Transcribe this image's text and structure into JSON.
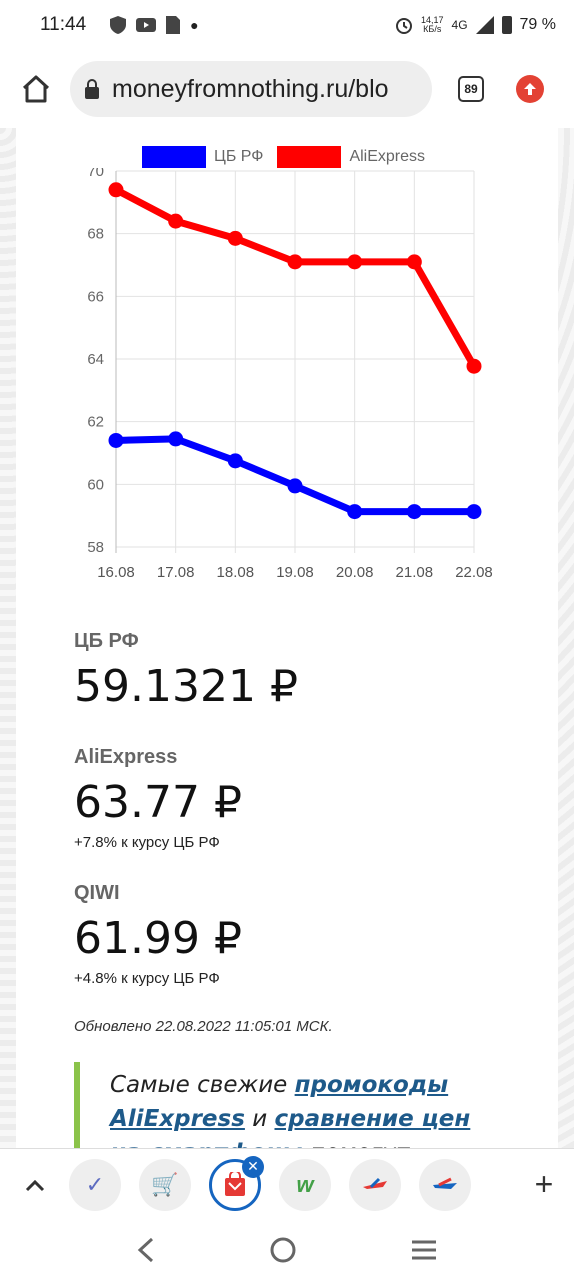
{
  "status": {
    "time": "11:44",
    "speed_top": "14,17",
    "speed_unit": "КБ/s",
    "network": "4G",
    "battery": "79 %"
  },
  "browser": {
    "url": "moneyfromnothing.ru/blo",
    "tabs_count": "89"
  },
  "chart_data": {
    "type": "line",
    "x": [
      "16.08",
      "17.08",
      "18.08",
      "19.08",
      "20.08",
      "21.08",
      "22.08"
    ],
    "series": [
      {
        "name": "ЦБ РФ",
        "color": "#0000ff",
        "values": [
          61.4,
          61.45,
          60.75,
          59.95,
          59.13,
          59.13,
          59.13
        ]
      },
      {
        "name": "AliExpress",
        "color": "#ff0000",
        "values": [
          69.4,
          68.4,
          67.85,
          67.1,
          67.1,
          67.1,
          63.77
        ]
      }
    ],
    "yticks": [
      "70",
      "68",
      "66",
      "64",
      "62",
      "60",
      "58"
    ],
    "ylim": [
      58,
      70
    ],
    "grid": true,
    "legend": "top"
  },
  "rates": {
    "cbr": {
      "label": "ЦБ РФ",
      "value": "59.1321 ₽"
    },
    "ali": {
      "label": "AliExpress",
      "value": "63.77 ₽",
      "diff": "+7.8% к курсу ЦБ РФ"
    },
    "qiwi": {
      "label": "QIWI",
      "value": "61.99 ₽",
      "diff": "+4.8% к курсу ЦБ РФ"
    }
  },
  "updated": "Обновлено 22.08.2022 11:05:01 МСК.",
  "quote": {
    "text_before": "Самые свежие ",
    "link1": "промокоды AliExpress",
    "text_mid": " и ",
    "link2": "сравнение цен на смартфоны",
    "text_after": " помогут"
  }
}
